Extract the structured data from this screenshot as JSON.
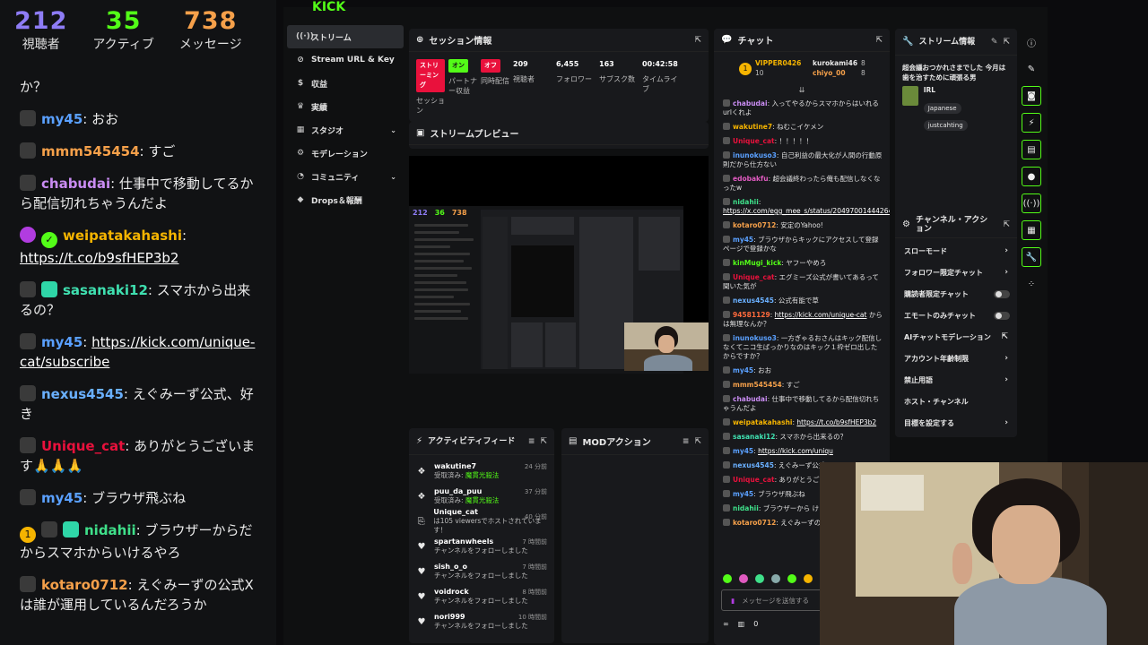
{
  "overlay": {
    "stats": [
      {
        "value": "212",
        "label": "視聴者"
      },
      {
        "value": "35",
        "label": "アクティブ"
      },
      {
        "value": "738",
        "label": "メッセージ"
      }
    ],
    "messages": [
      {
        "user": "",
        "text": "か？",
        "color": "#eaeaea"
      },
      {
        "user": "my45",
        "text": ": おお",
        "color": "#5aa0ff"
      },
      {
        "user": "mmm545454",
        "text": ": すご",
        "color": "#f5a04a"
      },
      {
        "user": "chabudai",
        "text": ": 仕事中で移動してるから配信切れちゃうんだよ",
        "color": "#c98cf2"
      },
      {
        "user": "weipatakahashi",
        "text": ":",
        "link": "https://t.co/b9sfHEP3b2",
        "color": "#f5b400"
      },
      {
        "user": "sasanaki12",
        "text": ": スマホから出来るの？",
        "color": "#3fe0b0"
      },
      {
        "user": "my45",
        "text": ":",
        "link": "https://kick.com/unique-cat/subscribe",
        "color": "#5aa0ff"
      },
      {
        "user": "nexus4545",
        "text": ": えぐみーず公式、好き",
        "color": "#6ab0ff"
      },
      {
        "user": "Unique_cat",
        "text": ": ありがとうございます🙏🙏🙏",
        "color": "#e9113c"
      },
      {
        "user": "my45",
        "text": ": ブラウザ飛ぶね",
        "color": "#5aa0ff"
      },
      {
        "user": "nidahii",
        "text": ": ブラウザーからだからスマホからいけるやろ",
        "color": "#3fe08a"
      },
      {
        "user": "kotaro0712",
        "text": ": えぐみーずの公式Xは誰が運用しているんだろうか",
        "color": "#f5a04a"
      }
    ]
  },
  "dash": {
    "logo": "KICK",
    "nav": [
      {
        "label": "ストリーム",
        "icon": "((·))",
        "active": true
      },
      {
        "label": "Stream URL & Key",
        "icon": "⊘"
      },
      {
        "label": "収益",
        "icon": "$"
      },
      {
        "label": "実績",
        "icon": "♛"
      },
      {
        "label": "スタジオ",
        "icon": "▦",
        "chev": "⌄"
      },
      {
        "label": "モデレーション",
        "icon": "⚙"
      },
      {
        "label": "コミュニティ",
        "icon": "◔",
        "chev": "⌄"
      },
      {
        "label": "Drops＆報酬",
        "icon": "◆"
      }
    ],
    "session": {
      "title": "セッション情報",
      "cells": [
        {
          "tag": "ストリーミング",
          "tagcls": "red",
          "label": "セッション"
        },
        {
          "tag": "オン",
          "tagcls": "grn",
          "label": "パートナー収益"
        },
        {
          "tag": "オフ",
          "tagcls": "org",
          "label": "同時配信"
        },
        {
          "value": "209",
          "label": "視聴者"
        },
        {
          "value": "6,455",
          "label": "フォロワー"
        },
        {
          "value": "163",
          "label": "サブスク数"
        },
        {
          "value": "00:42:58",
          "label": "タイムライブ"
        }
      ]
    },
    "preview": {
      "title": "ストリームプレビュー",
      "mini_stats": [
        "212",
        "36",
        "738"
      ]
    },
    "activity": {
      "title": "アクティビティフィード",
      "items": [
        {
          "icon": "❖",
          "name": "wakutine7",
          "desc": "受取済み: ",
          "gift": "魔貫光殺法",
          "time": "24 分前"
        },
        {
          "icon": "❖",
          "name": "puu_da_puu",
          "desc": "受取済み: ",
          "gift": "魔貫光殺法",
          "time": "37 分前"
        },
        {
          "icon": "⎘",
          "name": "Unique_cat",
          "desc": "は105 viewersでホストされています！",
          "gift": "",
          "time": "40 分前"
        },
        {
          "icon": "♥",
          "name": "spartanwheels",
          "desc": "チャンネルをフォローしました",
          "gift": "",
          "time": "7 時間前"
        },
        {
          "icon": "♥",
          "name": "sish_o_o",
          "desc": "チャンネルをフォローしました",
          "gift": "",
          "time": "7 時間前"
        },
        {
          "icon": "♥",
          "name": "voidrock",
          "desc": "チャンネルをフォローしました",
          "gift": "",
          "time": "8 時間前"
        },
        {
          "icon": "♥",
          "name": "nori999",
          "desc": "チャンネルをフォローしました",
          "gift": "",
          "time": "10 時間前"
        }
      ]
    },
    "mod": {
      "title": "MODアクション"
    },
    "chat": {
      "title": "チャット",
      "top": {
        "rank1": "VIPPER0426",
        "rank1_count": "10",
        "rank2": "kurokami46",
        "rank2_count": "8",
        "rank3": "chiyo_00",
        "rank3_count": "8"
      },
      "messages": [
        {
          "user": "chabudai",
          "color": "#c98cf2",
          "text": ": 入ってやるからスマホからはいれるurlくれよ"
        },
        {
          "user": "wakutine7",
          "color": "#f5b400",
          "text": ": ねむこイケメン"
        },
        {
          "user": "Unique_cat",
          "color": "#e9113c",
          "text": ": ！！！！！"
        },
        {
          "user": "inunokuso3",
          "color": "#5aa0ff",
          "text": ": 自己利益の最大化が人間の行動原則だから仕方ない"
        },
        {
          "user": "edobakfu",
          "color": "#e05ac0",
          "text": ": 超会議終わったら俺も配信しなくなったw"
        },
        {
          "user": "nidahii",
          "color": "#3fe08a",
          "text": ":",
          "link": "https://x.com/egg_mee_s/status/2049700144426426747"
        },
        {
          "user": "kotaro0712",
          "color": "#f5a04a",
          "text": ": 安定のYahoo!"
        },
        {
          "user": "my45",
          "color": "#5aa0ff",
          "text": ": ブラウザからキックにアクセスして登録ページで登録かな"
        },
        {
          "user": "kinMugi_kick",
          "color": "#53fc18",
          "text": ": ヤフーやめろ"
        },
        {
          "user": "Unique_cat",
          "color": "#e9113c",
          "text": ": エグミーズ公式が書いてあるって聞いた気が"
        },
        {
          "user": "nexus4545",
          "color": "#6ab0ff",
          "text": ": 公式有能で草"
        },
        {
          "user": "94581129",
          "color": "#ff6a3c",
          "text": ":",
          "link": "https://kick.com/unique-cat",
          "tail": "からは無理なんか？"
        },
        {
          "user": "inunokuso3",
          "color": "#5aa0ff",
          "text": ": 一方ぎゃるおさんはキック配信しなくてニコ生ばっかりなのはキック１枠ゼロ出したからですか？"
        },
        {
          "user": "my45",
          "color": "#5aa0ff",
          "text": ": おお"
        },
        {
          "user": "mmm545454",
          "color": "#f5a04a",
          "text": ": すご"
        },
        {
          "user": "chabudai",
          "color": "#c98cf2",
          "text": ": 仕事中で移動してるから配信切れちゃうんだよ"
        },
        {
          "user": "weipatakahashi",
          "color": "#f5b400",
          "text": ":",
          "link": "https://t.co/b9sfHEP3b2"
        },
        {
          "user": "sasanaki12",
          "color": "#3fe0b0",
          "text": ": スマホから出来るの？"
        },
        {
          "user": "my45",
          "color": "#5aa0ff",
          "text": ":",
          "link": "https://kick.com/uniqu"
        },
        {
          "user": "nexus4545",
          "color": "#6ab0ff",
          "text": ": えぐみーず公式、"
        },
        {
          "user": "Unique_cat",
          "color": "#e9113c",
          "text": ": ありがとうござい"
        },
        {
          "user": "my45",
          "color": "#5aa0ff",
          "text": ": ブラウザ飛ぶね"
        },
        {
          "user": "nidahii",
          "color": "#3fe08a",
          "text": ": ブラウザーから けるやろ"
        },
        {
          "user": "kotaro0712",
          "color": "#f5a04a",
          "text": ": えぐみーずの公式 んだろうか"
        }
      ],
      "input_placeholder": "メッセージを送信する",
      "bottom_count": "0",
      "bottom_infinity": "∞"
    },
    "stream_info": {
      "title": "ストリーム情報",
      "text": "超会議おつかれさまでした 今月は歯を治すために頑張る男",
      "category": "IRL",
      "tags": [
        "Japanese",
        "justcahting"
      ]
    },
    "channel_actions": {
      "title": "チャンネル・アクション",
      "rows": [
        {
          "label": "スローモード",
          "kind": "chev"
        },
        {
          "label": "フォロワー限定チャット",
          "kind": "chev"
        },
        {
          "label": "購読者限定チャット",
          "kind": "toggle"
        },
        {
          "label": "エモートのみチャット",
          "kind": "toggle"
        },
        {
          "label": "AIチャットモデレーション",
          "kind": "ext"
        },
        {
          "label": "アカウント年齢制限",
          "kind": "chev"
        },
        {
          "label": "禁止用語",
          "kind": "chev"
        },
        {
          "label": "ホスト・チャンネル",
          "kind": "none"
        },
        {
          "label": "目標を設定する",
          "kind": "chev"
        }
      ]
    }
  }
}
